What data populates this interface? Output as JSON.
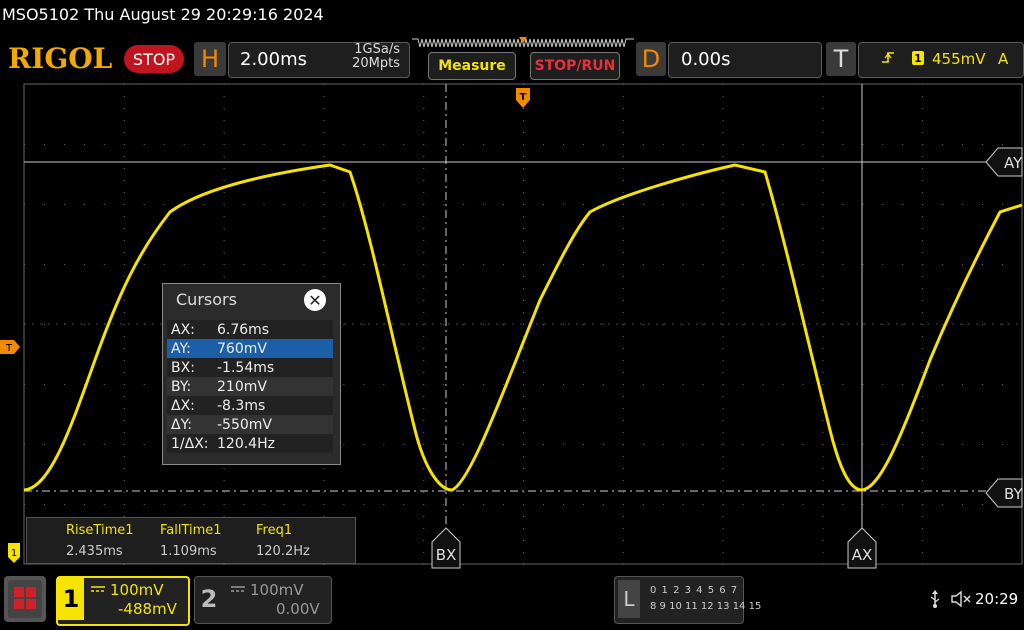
{
  "status": {
    "text": "MSO5102  Thu August 29 20:29:16 2024"
  },
  "toolbar": {
    "logo": "RIGOL",
    "stop": "STOP",
    "h_label": "H",
    "timebase": "2.00ms",
    "sample_rate": "1GSa/s",
    "memory_depth": "20Mpts",
    "measure": "Measure",
    "stop_run": "STOP/RUN",
    "d_label": "D",
    "delay": "0.00s",
    "t_label": "T",
    "trigger_source": "1",
    "trigger_level": "455mV",
    "trigger_mode": "A"
  },
  "markers": {
    "trigger_pos": "T",
    "trigger_level": "T",
    "ch1_ground": "1"
  },
  "cursor_labels": {
    "ay": "AY",
    "by": "BY",
    "bx": "BX",
    "ax": "AX"
  },
  "cursors": {
    "title": "Cursors",
    "close": "✕",
    "rows": [
      {
        "k": "AX:",
        "v": "6.76ms"
      },
      {
        "k": "AY:",
        "v": "760mV"
      },
      {
        "k": "BX:",
        "v": "-1.54ms"
      },
      {
        "k": "BY:",
        "v": "210mV"
      },
      {
        "k": "ΔX:",
        "v": "-8.3ms"
      },
      {
        "k": "ΔY:",
        "v": "-550mV"
      },
      {
        "k": "1/ΔX:",
        "v": "120.4Hz"
      }
    ],
    "selected_row": 1
  },
  "measurements": [
    {
      "name": "RiseTime1",
      "value": "2.435ms"
    },
    {
      "name": "FallTime1",
      "value": "1.109ms"
    },
    {
      "name": "Freq1",
      "value": "120.2Hz"
    }
  ],
  "bottom": {
    "ch1_num": "1",
    "ch1_scale": "100mV",
    "ch1_offset": "-488mV",
    "ch2_num": "2",
    "ch2_scale": "100mV",
    "ch2_offset": "0.00V",
    "la_letter": "L",
    "la_row1": "0 1 2 3  4 5 6 7",
    "la_row2": "8 9 10 11 12 13 14 15",
    "time": "20:29"
  },
  "colors": {
    "ch1": "#f5e400",
    "accent": "#f28a00",
    "stop": "#c0141e"
  },
  "icons": {
    "usb": "usb-icon",
    "speaker": "speaker-muted-icon",
    "menu": "menu-grid-icon"
  }
}
